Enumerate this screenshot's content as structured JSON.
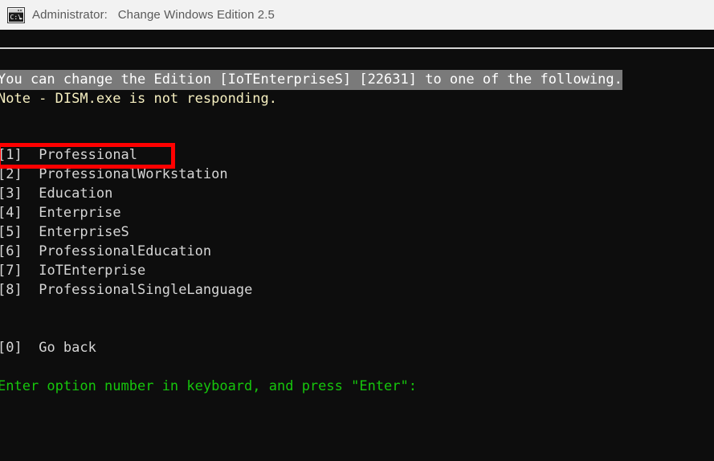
{
  "window": {
    "icon_name": "cmd-console-icon",
    "title": "Administrator:   Change Windows Edition 2.5",
    "titlebar_bg": "#f2f2f2",
    "title_color": "#5a5a5a"
  },
  "terminal": {
    "background": "#0d0d0d",
    "default_text_color": "#d6d6d6",
    "lines": {
      "header": "You can change the Edition [IoTEnterpriseS] [22631] to one of the following.",
      "note": "Note - DISM.exe is not responding.",
      "go_back_key": "[0]",
      "go_back_label": "Go back",
      "prompt": "Enter option number in keyboard, and press \"Enter\":"
    },
    "colors": {
      "highlight_bg": "#7a7a7a",
      "highlight_fg": "#ffffff",
      "warning": "#f6efc0",
      "prompt_green": "#16c60c",
      "annotation_red": "#ff0000",
      "rule": "#d4d4d4"
    },
    "options": [
      {
        "key": "[1]",
        "label": "Professional"
      },
      {
        "key": "[2]",
        "label": "ProfessionalWorkstation"
      },
      {
        "key": "[3]",
        "label": "Education"
      },
      {
        "key": "[4]",
        "label": "Enterprise"
      },
      {
        "key": "[5]",
        "label": "EnterpriseS"
      },
      {
        "key": "[6]",
        "label": "ProfessionalEducation"
      },
      {
        "key": "[7]",
        "label": "IoTEnterprise"
      },
      {
        "key": "[8]",
        "label": "ProfessionalSingleLanguage"
      }
    ]
  }
}
